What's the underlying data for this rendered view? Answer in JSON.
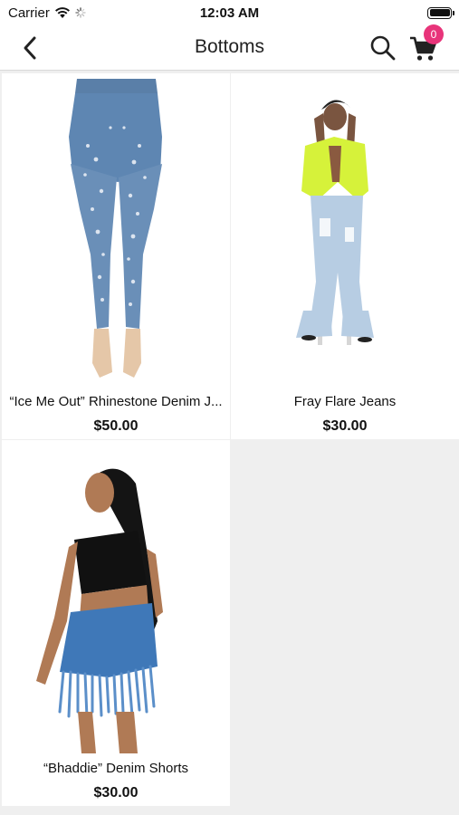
{
  "status_bar": {
    "carrier": "Carrier",
    "time": "12:03 AM"
  },
  "nav": {
    "title": "Bottoms",
    "cart_count": "0",
    "icons": [
      "back-chevron-icon",
      "search-icon",
      "cart-icon"
    ]
  },
  "colors": {
    "badge": "#e8347a",
    "background": "#efefef",
    "card": "#ffffff"
  },
  "products": [
    {
      "name": "“Ice Me Out” Rhinestone Denim J...",
      "price": "$50.00"
    },
    {
      "name": "Fray Flare Jeans",
      "price": "$30.00"
    },
    {
      "name": "“Bhaddie” Denim Shorts",
      "price": "$30.00"
    }
  ]
}
